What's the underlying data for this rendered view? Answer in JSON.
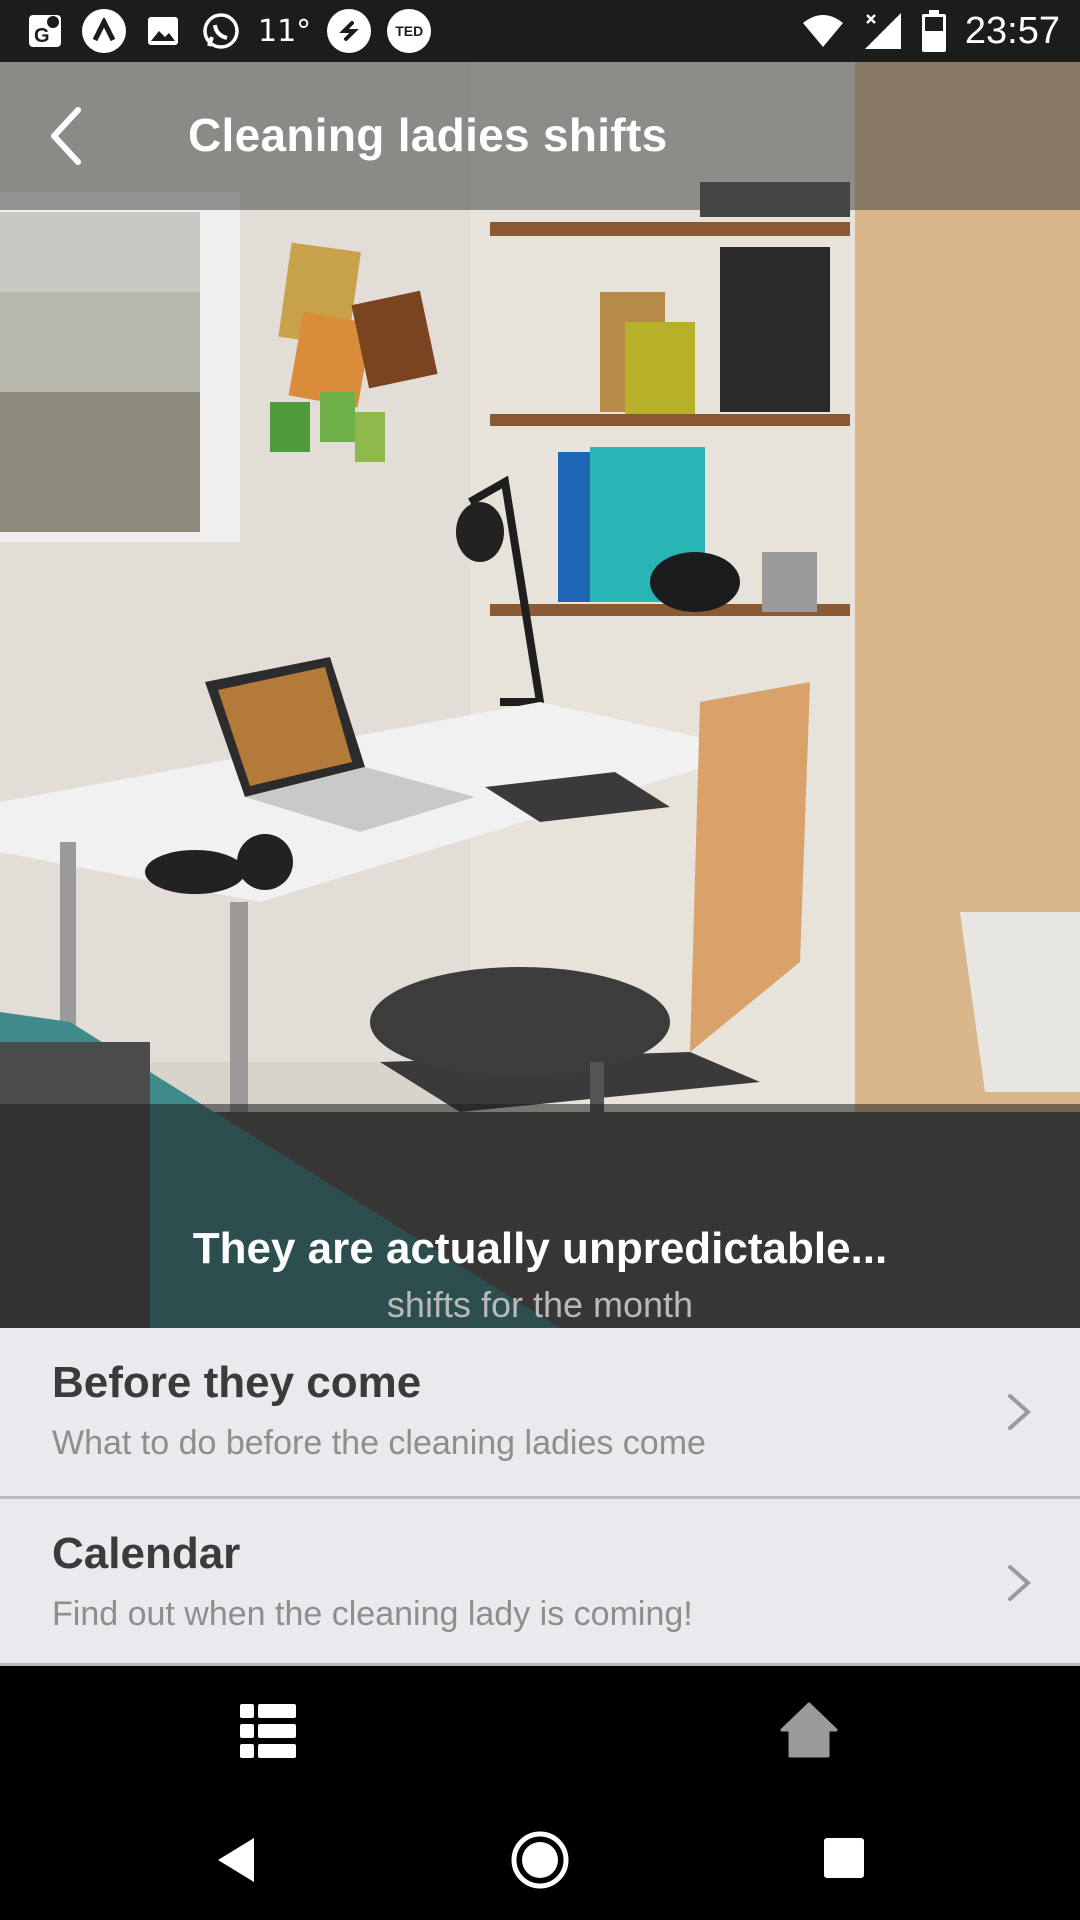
{
  "status_bar": {
    "temperature": "11°",
    "time": "23:57",
    "icons": [
      "maps-icon",
      "alpha-app-icon",
      "image-icon",
      "whatsapp-icon",
      "shazam-icon",
      "ted-icon",
      "wifi-icon",
      "signal-icon",
      "battery-icon"
    ],
    "ted_label": "TED"
  },
  "toolbar": {
    "title": "Cleaning ladies shifts",
    "back_icon": "back-arrow-icon"
  },
  "hero": {
    "caption_title": "They are actually unpredictable...",
    "caption_subtitle": "shifts for the month"
  },
  "list": {
    "items": [
      {
        "title": "Before they come",
        "subtitle": "What to do before the cleaning ladies come",
        "icon": "chevron-right-icon"
      },
      {
        "title": "Calendar",
        "subtitle": "Find out when the cleaning lady is coming!",
        "icon": "chevron-right-icon"
      }
    ]
  },
  "tab_bar": {
    "tabs": [
      {
        "name": "list-icon"
      },
      {
        "name": "home-icon"
      }
    ]
  },
  "nav_bar": {
    "buttons": [
      "back-triangle-icon",
      "home-circle-icon",
      "recents-square-icon"
    ]
  }
}
